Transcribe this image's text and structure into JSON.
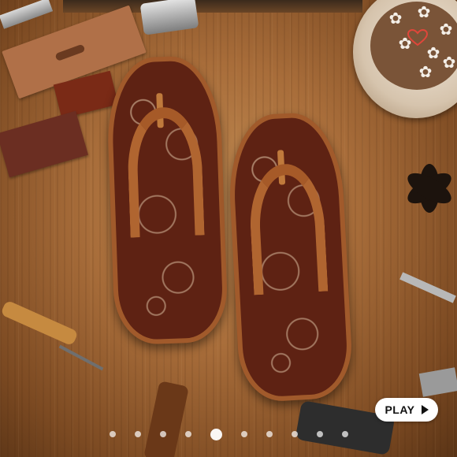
{
  "media": {
    "subject": "sandals-on-workbench",
    "play_label": "PLAY",
    "play_icon": "play-triangle-icon",
    "heart_icon": "heart-outline-icon",
    "heart_color": "#e0463a"
  },
  "carousel": {
    "dot_count": 10,
    "active_index": 4
  },
  "colors": {
    "wood": "#a86d3a",
    "sandal_leather": "#5e2213",
    "strap": "#b06530",
    "button_bg": "#ffffff",
    "button_text": "#111111"
  }
}
